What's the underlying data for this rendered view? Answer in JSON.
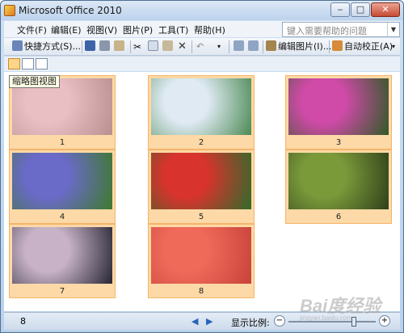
{
  "window": {
    "title": "Microsoft Office 2010"
  },
  "menu": {
    "items": [
      "文件(F)",
      "编辑(E)",
      "视图(V)",
      "图片(P)",
      "工具(T)",
      "帮助(H)"
    ],
    "help_placeholder": "键入需要帮助的问题"
  },
  "toolbar": {
    "shortcuts_label": "快捷方式(S)...",
    "edit_label": "编辑图片(I)...",
    "autocorrect_label": "自动校正(A)"
  },
  "viewbar": {
    "tooltip": "缩略图视图"
  },
  "thumbnails": [
    {
      "number": "1",
      "desc": "pink cherry blossoms",
      "colors": [
        "#e9bfc4",
        "#b98f8f"
      ]
    },
    {
      "number": "2",
      "desc": "white flowers on green",
      "colors": [
        "#dfeaf3",
        "#4c8a54"
      ]
    },
    {
      "number": "3",
      "desc": "magenta cosmos flowers",
      "colors": [
        "#d04aa8",
        "#2f5a25"
      ]
    },
    {
      "number": "4",
      "desc": "purple flower field",
      "colors": [
        "#6a6ac8",
        "#3d7a2c"
      ]
    },
    {
      "number": "5",
      "desc": "red berries on branch",
      "colors": [
        "#d8332c",
        "#2f6b2b"
      ]
    },
    {
      "number": "6",
      "desc": "mushrooms on moss",
      "colors": [
        "#7a9a3a",
        "#2f3f1a"
      ]
    },
    {
      "number": "7",
      "desc": "pale rose on dark background",
      "colors": [
        "#c8b2c8",
        "#262633"
      ]
    },
    {
      "number": "8",
      "desc": "coral rose",
      "colors": [
        "#f06a5a",
        "#c8423a"
      ]
    }
  ],
  "status": {
    "count": "8",
    "zoom_label": "显示比例:"
  },
  "watermark": {
    "brand": "Bai度经验",
    "url": "jingyan.baidu.com"
  }
}
